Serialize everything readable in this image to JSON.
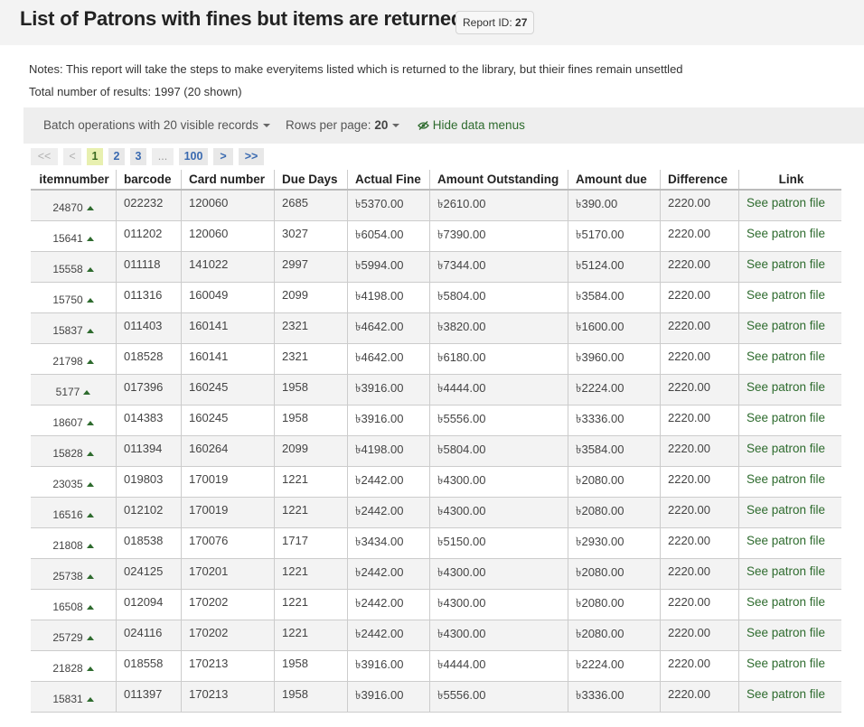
{
  "header": {
    "title": "List of Patrons with fines but items are returned",
    "report_id_label": "Report ID:",
    "report_id": "27"
  },
  "notes": {
    "label": "Notes:",
    "text": "This report will take the steps to make everyitems listed which is returned to the library, but thieir fines remain unsettled"
  },
  "total": {
    "label": "Total number of results:",
    "value": "1997 (20 shown)"
  },
  "toolbar": {
    "batch_label": "Batch operations with 20 visible records",
    "rows_label": "Rows per page:",
    "rows_value": "20",
    "hide_menus_label": "Hide data menus",
    "hide_icon": "eye-slash-icon"
  },
  "pagination": {
    "first": "<<",
    "prev": "<",
    "pages": [
      "1",
      "2",
      "3"
    ],
    "ellipsis": "...",
    "last_page": "100",
    "next": ">",
    "last": ">>"
  },
  "table": {
    "columns": [
      "itemnumber",
      "barcode",
      "Card number",
      "Due Days",
      "Actual Fine",
      "Amount Outstanding",
      "Amount due",
      "Difference",
      "Link"
    ],
    "link_text": "See patron file",
    "rows": [
      [
        "24870",
        "022232",
        "120060",
        "2685",
        "৳5370.00",
        "৳2610.00",
        "৳390.00",
        "2220.00"
      ],
      [
        "15641",
        "011202",
        "120060",
        "3027",
        "৳6054.00",
        "৳7390.00",
        "৳5170.00",
        "2220.00"
      ],
      [
        "15558",
        "011118",
        "141022",
        "2997",
        "৳5994.00",
        "৳7344.00",
        "৳5124.00",
        "2220.00"
      ],
      [
        "15750",
        "011316",
        "160049",
        "2099",
        "৳4198.00",
        "৳5804.00",
        "৳3584.00",
        "2220.00"
      ],
      [
        "15837",
        "011403",
        "160141",
        "2321",
        "৳4642.00",
        "৳3820.00",
        "৳1600.00",
        "2220.00"
      ],
      [
        "21798",
        "018528",
        "160141",
        "2321",
        "৳4642.00",
        "৳6180.00",
        "৳3960.00",
        "2220.00"
      ],
      [
        "5177",
        "017396",
        "160245",
        "1958",
        "৳3916.00",
        "৳4444.00",
        "৳2224.00",
        "2220.00"
      ],
      [
        "18607",
        "014383",
        "160245",
        "1958",
        "৳3916.00",
        "৳5556.00",
        "৳3336.00",
        "2220.00"
      ],
      [
        "15828",
        "011394",
        "160264",
        "2099",
        "৳4198.00",
        "৳5804.00",
        "৳3584.00",
        "2220.00"
      ],
      [
        "23035",
        "019803",
        "170019",
        "1221",
        "৳2442.00",
        "৳4300.00",
        "৳2080.00",
        "2220.00"
      ],
      [
        "16516",
        "012102",
        "170019",
        "1221",
        "৳2442.00",
        "৳4300.00",
        "৳2080.00",
        "2220.00"
      ],
      [
        "21808",
        "018538",
        "170076",
        "1717",
        "৳3434.00",
        "৳5150.00",
        "৳2930.00",
        "2220.00"
      ],
      [
        "25738",
        "024125",
        "170201",
        "1221",
        "৳2442.00",
        "৳4300.00",
        "৳2080.00",
        "2220.00"
      ],
      [
        "16508",
        "012094",
        "170202",
        "1221",
        "৳2442.00",
        "৳4300.00",
        "৳2080.00",
        "2220.00"
      ],
      [
        "25729",
        "024116",
        "170202",
        "1221",
        "৳2442.00",
        "৳4300.00",
        "৳2080.00",
        "2220.00"
      ],
      [
        "21828",
        "018558",
        "170213",
        "1958",
        "৳3916.00",
        "৳4444.00",
        "৳2224.00",
        "2220.00"
      ],
      [
        "15831",
        "011397",
        "170213",
        "1958",
        "৳3916.00",
        "৳5556.00",
        "৳3336.00",
        "2220.00"
      ]
    ]
  }
}
